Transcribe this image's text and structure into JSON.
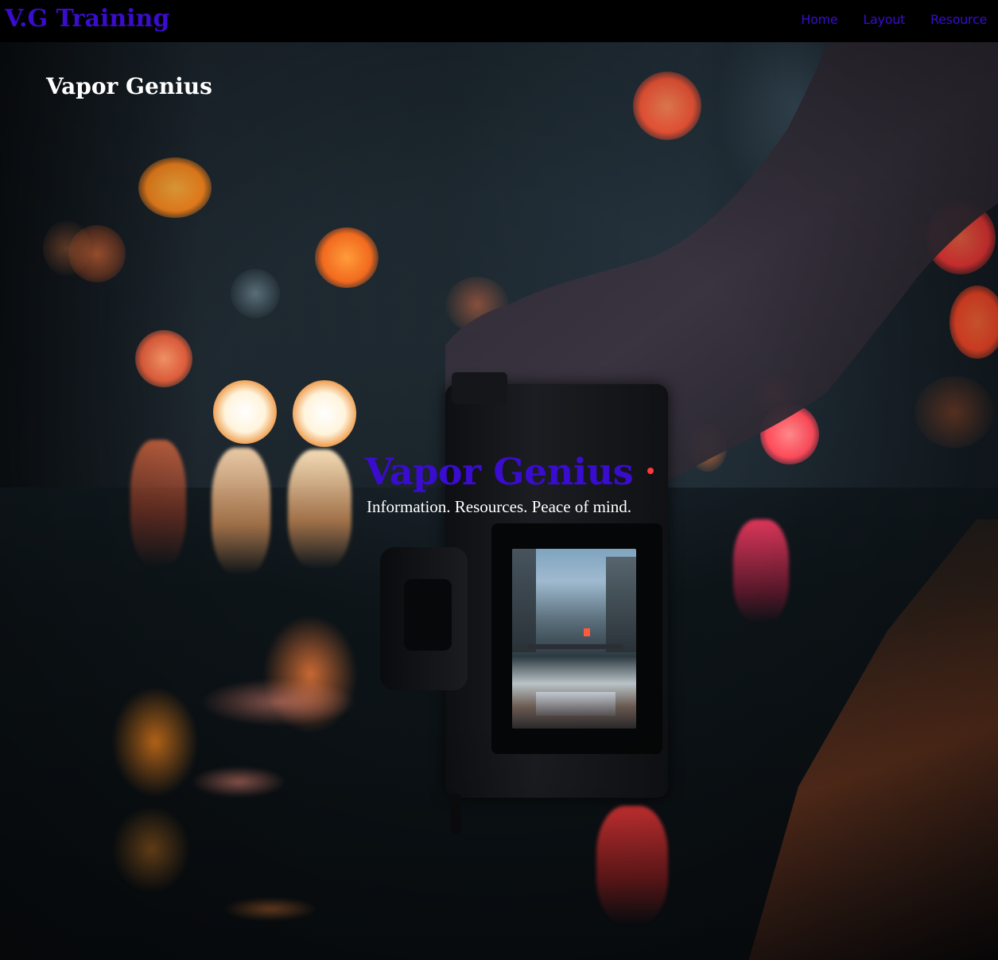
{
  "navbar": {
    "brand": "V.G Training",
    "links": [
      "Home",
      "Layout",
      "Resource"
    ]
  },
  "hero": {
    "top_title": "Vapor Genius",
    "heading": "Vapor Genius",
    "tagline": "Information. Resources. Peace of mind.",
    "image": "hand-holding-camera-over-wet-city-street-at-night"
  },
  "colors": {
    "accent": "#3a0ccf",
    "navbar_background": "#000000",
    "overlay_text": "#ffffff"
  }
}
